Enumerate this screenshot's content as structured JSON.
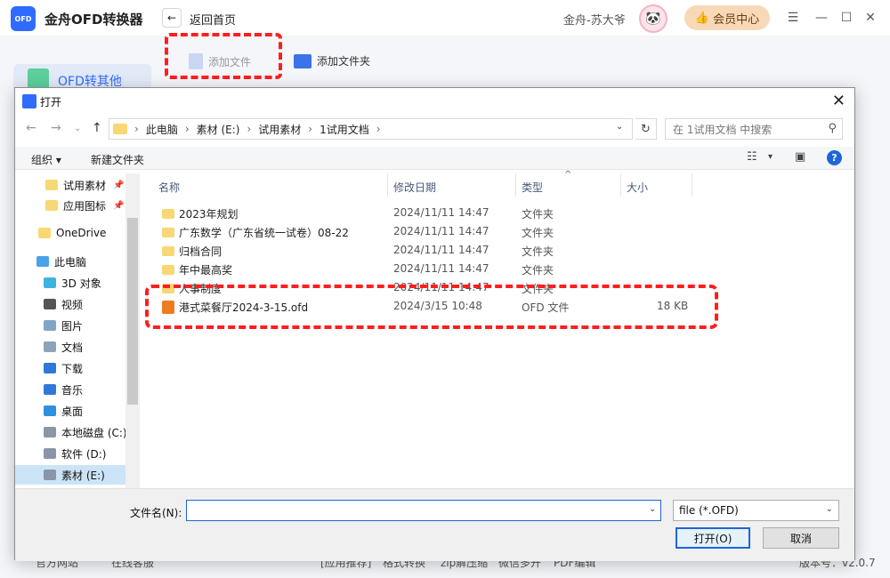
{
  "app": {
    "title": "金舟OFD转换器",
    "logo_text": "OFD",
    "back_label": "返回首页",
    "user_name": "金舟-苏大爷",
    "vip_label": "会员中心",
    "add_file_label": "添加文件",
    "add_folder_label": "添加文件夹",
    "side_nav_label": "OFD转其他",
    "status_items": [
      "官方网站",
      "在线客服",
      "[应用推荐]",
      "格式转换",
      "zip解压缩",
      "微信多开",
      "PDF编辑"
    ],
    "version": "版本号：v2.0.7"
  },
  "dialog": {
    "title": "打开",
    "breadcrumb": [
      "此电脑",
      "素材 (E:)",
      "试用素材",
      "1试用文档"
    ],
    "search_placeholder": "在 1试用文档 中搜索",
    "organize_label": "组织 ▾",
    "new_folder_label": "新建文件夹",
    "tree": [
      {
        "label": "试用素材",
        "pinned": true,
        "icon": "folder-icon"
      },
      {
        "label": "应用图标",
        "pinned": true,
        "icon": "folder-icon"
      },
      {
        "label": "OneDrive",
        "pinned": false,
        "icon": "folder-icon"
      },
      {
        "label": "此电脑",
        "pinned": false,
        "icon": "computer-icon"
      },
      {
        "label": "3D 对象",
        "pinned": false,
        "icon": "cube-icon"
      },
      {
        "label": "视频",
        "pinned": false,
        "icon": "video-icon"
      },
      {
        "label": "图片",
        "pinned": false,
        "icon": "picture-icon"
      },
      {
        "label": "文档",
        "pinned": false,
        "icon": "document-icon"
      },
      {
        "label": "下载",
        "pinned": false,
        "icon": "download-icon"
      },
      {
        "label": "音乐",
        "pinned": false,
        "icon": "music-icon"
      },
      {
        "label": "桌面",
        "pinned": false,
        "icon": "desktop-icon"
      },
      {
        "label": "本地磁盘 (C:)",
        "pinned": false,
        "icon": "drive-icon"
      },
      {
        "label": "软件 (D:)",
        "pinned": false,
        "icon": "drive-icon"
      },
      {
        "label": "素材 (E:)",
        "pinned": false,
        "icon": "drive-icon",
        "selected": true
      }
    ],
    "columns": {
      "name": "名称",
      "date": "修改日期",
      "type": "类型",
      "size": "大小"
    },
    "files": [
      {
        "name": "2023年规划",
        "date": "2024/11/11 14:47",
        "type": "文件夹",
        "size": "",
        "kind": "folder"
      },
      {
        "name": "广东数学（广东省统一试卷）08-22",
        "date": "2024/11/11 14:47",
        "type": "文件夹",
        "size": "",
        "kind": "folder"
      },
      {
        "name": "归档合同",
        "date": "2024/11/11 14:47",
        "type": "文件夹",
        "size": "",
        "kind": "folder"
      },
      {
        "name": "年中最高奖",
        "date": "2024/11/11 14:47",
        "type": "文件夹",
        "size": "",
        "kind": "folder"
      },
      {
        "name": "人事制度",
        "date": "2024/11/11 14:47",
        "type": "文件夹",
        "size": "",
        "kind": "folder"
      },
      {
        "name": "港式菜餐厅2024-3-15.ofd",
        "date": "2024/3/15 10:48",
        "type": "OFD 文件",
        "size": "18 KB",
        "kind": "ofd"
      }
    ],
    "filename_label": "文件名(N):",
    "filename_value": "",
    "filetype_value": "file (*.OFD)",
    "open_label": "打开(O)",
    "cancel_label": "取消"
  }
}
